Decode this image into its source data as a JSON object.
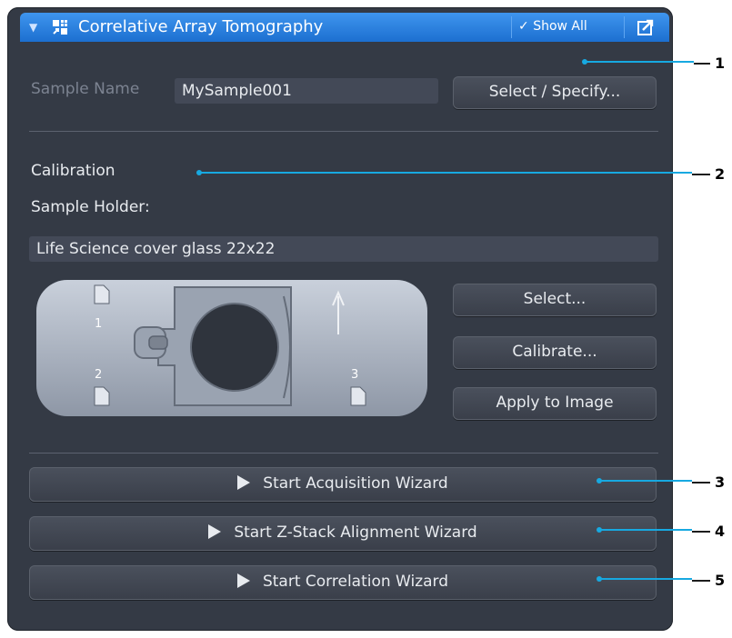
{
  "header": {
    "title": "Correlative Array Tomography",
    "show_all_label": "Show All"
  },
  "sample": {
    "label": "Sample Name",
    "value": "MySample001",
    "select_button": "Select / Specify..."
  },
  "calibration": {
    "heading": "Calibration",
    "holder_label": "Sample Holder:",
    "holder_value": "Life Science cover glass 22x22",
    "markers": [
      "1",
      "2",
      "3"
    ],
    "buttons": {
      "select": "Select...",
      "calibrate": "Calibrate...",
      "apply": "Apply to Image"
    }
  },
  "wizards": [
    "Start Acquisition Wizard",
    "Start Z-Stack Alignment Wizard",
    "Start Correlation Wizard"
  ],
  "callouts": [
    "1",
    "2",
    "3",
    "4",
    "5"
  ],
  "colors": {
    "panel": "#343a45",
    "title_bar": "#2a84e6",
    "callout_line": "#17a9e1"
  }
}
